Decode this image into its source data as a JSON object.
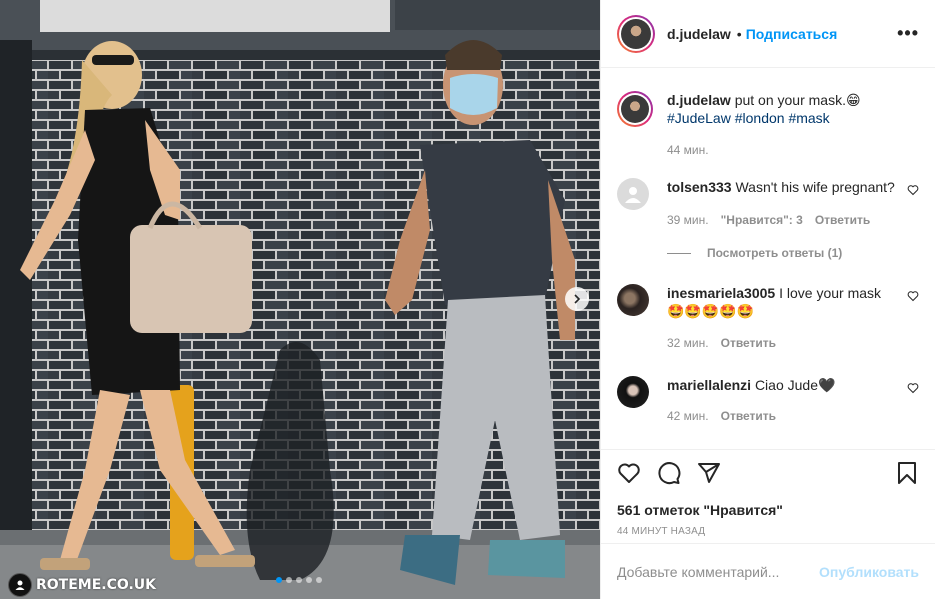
{
  "photo": {
    "watermark": "ROTEME.CO.UK",
    "slide_count": 5,
    "active_slide": 1
  },
  "header": {
    "username": "d.judelaw",
    "separator": "•",
    "follow_label": "Подписаться",
    "more_label": "•••"
  },
  "caption": {
    "username": "d.judelaw",
    "text": "put on your mask.",
    "emoji": "😁",
    "hashtags": [
      "#JudeLaw",
      "#london",
      "#mask"
    ],
    "time": "44 мин."
  },
  "comments": [
    {
      "username": "tolsen333",
      "text": "Wasn't his wife pregnant?",
      "time": "39 мин.",
      "likes": "\"Нравится\": 3",
      "reply_label": "Ответить",
      "view_replies": "Посмотреть ответы (1)"
    },
    {
      "username": "inesmariela3005",
      "text": "I love your mask",
      "emoji_line": "🤩🤩🤩🤩🤩",
      "time": "32 мин.",
      "reply_label": "Ответить"
    },
    {
      "username": "mariellalenzi",
      "text": "Ciao Jude🖤",
      "time": "42 мин.",
      "reply_label": "Ответить"
    }
  ],
  "actions": {
    "likes_text": "561 отметок \"Нравится\"",
    "posted_time": "44 минут назад"
  },
  "add_comment": {
    "placeholder": "Добавьте комментарий...",
    "publish_label": "Опубликовать"
  },
  "colors": {
    "accent": "#0095f6",
    "hashtag": "#00376b",
    "muted": "#8e8e8e",
    "publish_disabled": "#b2dffc"
  }
}
